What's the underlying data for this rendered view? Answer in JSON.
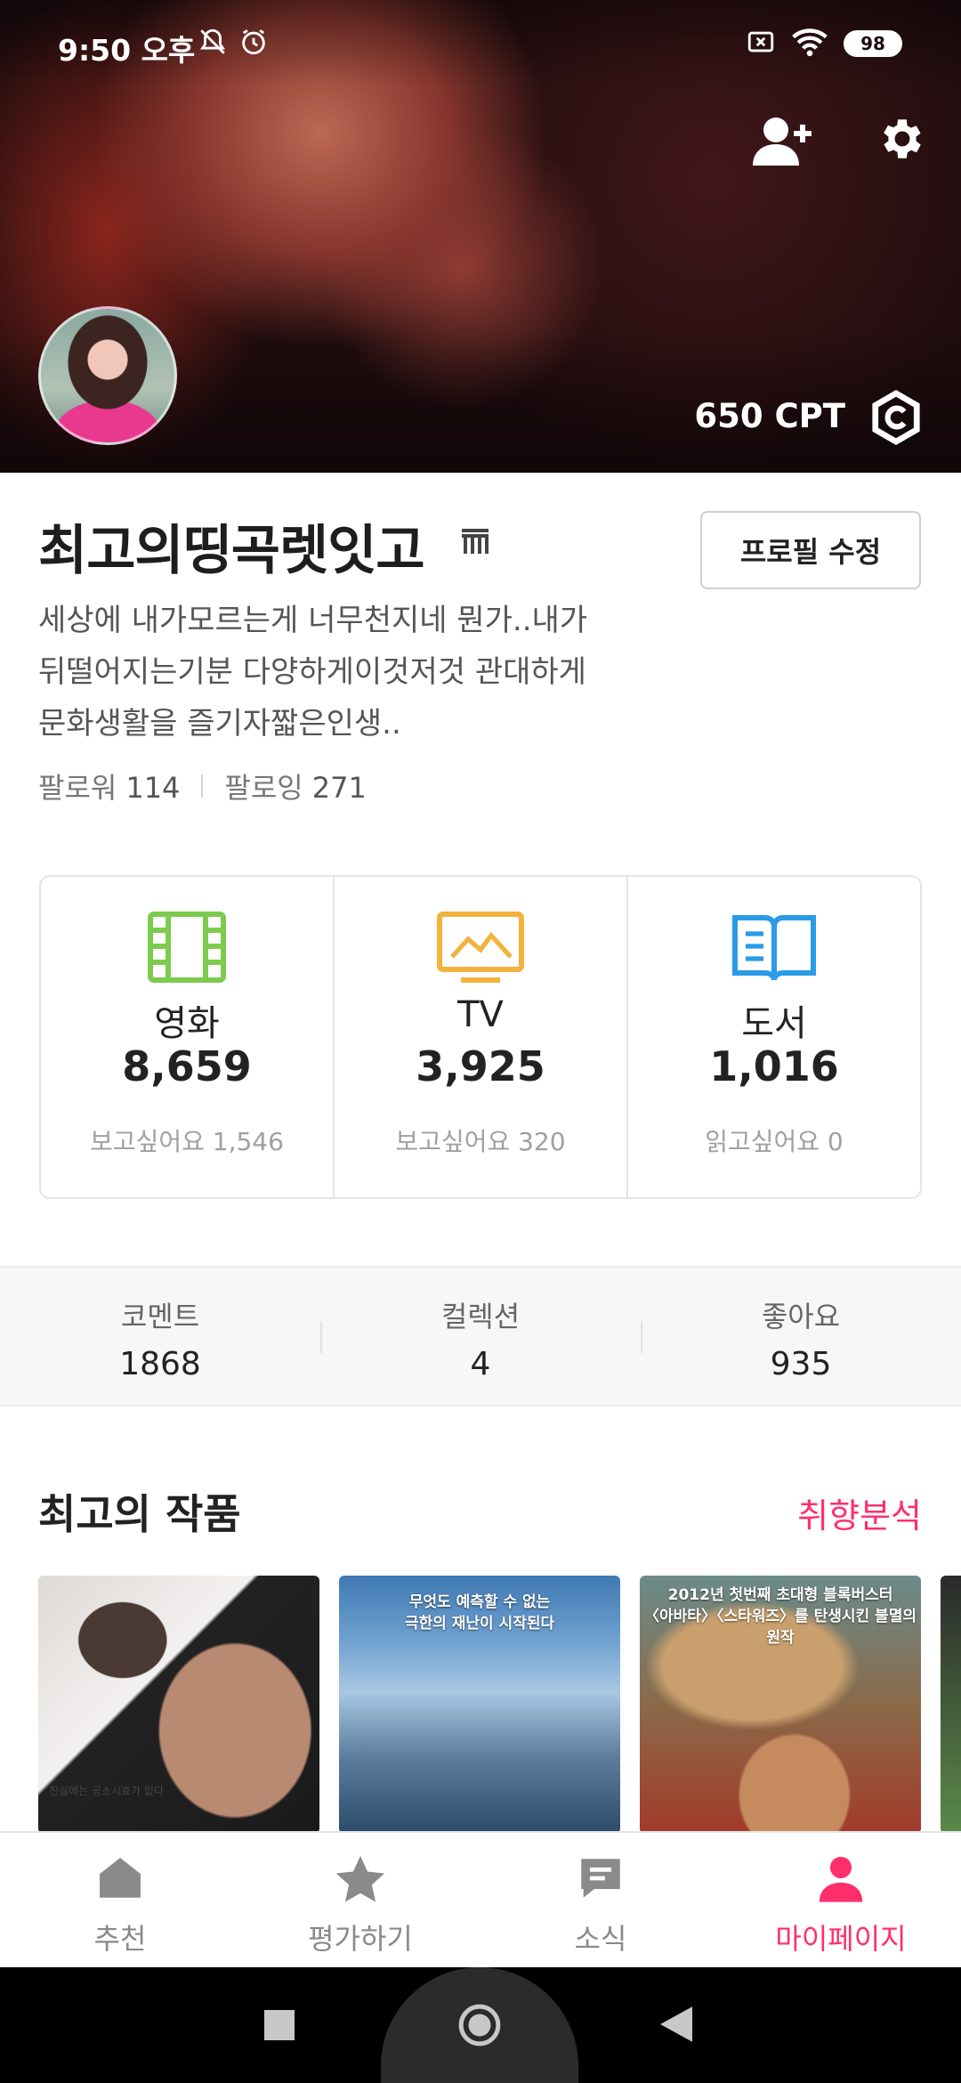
{
  "status_bar": {
    "time": "9:50 오후",
    "battery": "98",
    "icons": [
      "mute-icon",
      "alarm-icon",
      "no-sim-icon",
      "wifi-icon",
      "battery-icon"
    ]
  },
  "cover": {
    "points": "650 CPT",
    "actions": [
      "add-friend-icon",
      "settings-icon"
    ]
  },
  "profile": {
    "name": "최고의띵곡렛잇고",
    "edit_label": "프로필 수정",
    "bio_lines": [
      "세상에 내가모르는게 너무천지네 뭔가..내가",
      "뒤떨어지는기분 다양하게이것저것 관대하게",
      "문화생활을 즐기자짧은인생.."
    ],
    "followers_label": "팔로워",
    "followers_count": "114",
    "following_label": "팔로잉",
    "following_count": "271"
  },
  "categories": [
    {
      "title": "영화",
      "count": "8,659",
      "wish": "보고싶어요 1,546",
      "icon": "film-icon",
      "color": "#7dcb4e"
    },
    {
      "title": "TV",
      "count": "3,925",
      "wish": "보고싶어요 320",
      "icon": "tv-icon",
      "color": "#f2b33d"
    },
    {
      "title": "도서",
      "count": "1,016",
      "wish": "읽고싶어요 0",
      "icon": "book-icon",
      "color": "#2a9be6"
    }
  ],
  "stats": [
    {
      "label": "코멘트",
      "value": "1868"
    },
    {
      "label": "컬렉션",
      "value": "4"
    },
    {
      "label": "좋아요",
      "value": "935"
    }
  ],
  "best_works": {
    "title": "최고의 작품",
    "link": "취향분석",
    "posters": [
      {
        "caption": "",
        "small": "진실에는 공소시효가 없다"
      },
      {
        "caption": "무엇도 예측할 수 없는\n극한의 재난이 시작된다",
        "small": ""
      },
      {
        "caption": "2012년 첫번째 초대형 블록버스터\n〈아바타〉〈스타워즈〉를 탄생시킨 불멸의 원작",
        "small": ""
      }
    ]
  },
  "bottom_nav": [
    {
      "label": "추천",
      "icon": "home-icon",
      "active": false
    },
    {
      "label": "평가하기",
      "icon": "star-icon",
      "active": false
    },
    {
      "label": "소식",
      "icon": "chat-icon",
      "active": false
    },
    {
      "label": "마이페이지",
      "icon": "person-icon",
      "active": true
    }
  ],
  "colors": {
    "accent": "#ff2f6e",
    "inactive_nav": "#8a8a8a"
  }
}
